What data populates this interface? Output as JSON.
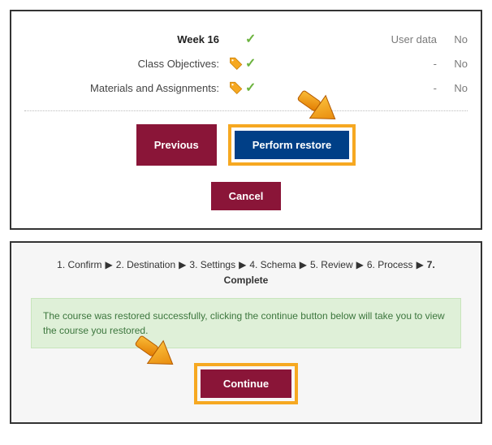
{
  "panel1": {
    "rows": [
      {
        "label": "Week 16",
        "hasTag": false,
        "check": true,
        "ud_label": "User data",
        "ud_value": "No"
      },
      {
        "label": "Class Objectives:",
        "hasTag": true,
        "check": true,
        "ud_label": "-",
        "ud_value": "No"
      },
      {
        "label": "Materials and Assignments:",
        "hasTag": true,
        "check": true,
        "ud_label": "-",
        "ud_value": "No"
      }
    ],
    "buttons": {
      "previous": "Previous",
      "perform": "Perform restore",
      "cancel": "Cancel"
    }
  },
  "panel2": {
    "steps": [
      "1. Confirm",
      "2. Destination",
      "3. Settings",
      "4. Schema",
      "5. Review",
      "6. Process",
      "7. Complete"
    ],
    "current_step_index": 6,
    "alert": "The course was restored successfully, clicking the continue button below will take you to view the course you restored.",
    "continue": "Continue"
  },
  "glyphs": {
    "step_sep": "▶",
    "check": "✓"
  }
}
